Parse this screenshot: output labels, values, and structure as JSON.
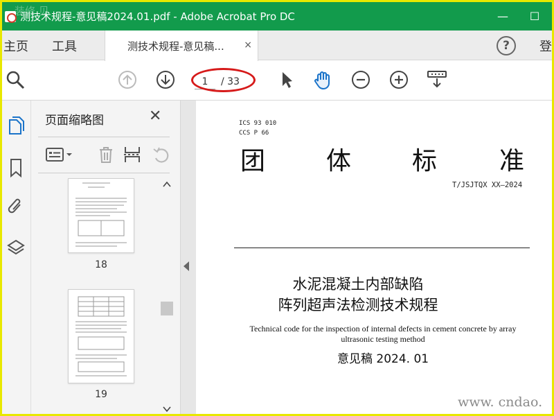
{
  "window": {
    "title": "测技术规程-意见稿2024.01.pdf - Adobe Acrobat Pro DC",
    "watermark": "装修 贝",
    "minimize_label": "—",
    "maximize_label": "☐"
  },
  "tabs": {
    "home": "主页",
    "tools": "工具",
    "document": "测技术规程-意见稿...",
    "close": "×",
    "help": "?",
    "login": "登"
  },
  "toolbar": {
    "current_page": "1",
    "total_pages": "/ 33"
  },
  "thumbnails_panel": {
    "header": "页面缩略图",
    "close": "✕",
    "pages": [
      {
        "number": "18"
      },
      {
        "number": "19"
      }
    ]
  },
  "document": {
    "ics_line1": "ICS 93 010",
    "ics_line2": "CCS P 66",
    "heading_chars": [
      "团",
      "体",
      "标",
      "准"
    ],
    "standard_number": "T/JSJTQX XX—2024",
    "title_line1": "水泥混凝土内部缺陷",
    "title_line2": "阵列超声法检测技术规程",
    "english_title": "Technical code for the inspection of internal defects in cement concrete by array ultrasonic testing method",
    "draft_label": "意见稿 2024. 01"
  },
  "watermark": "www. cndao. com",
  "colors": {
    "titlebar": "#129b4c",
    "annotation_ellipse": "#d61a1a",
    "frame": "#e8e800",
    "hand_tool": "#1a73c9"
  }
}
